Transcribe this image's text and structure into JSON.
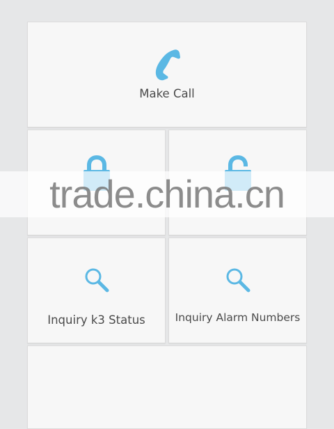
{
  "colors": {
    "accent": "#5bb8e4",
    "tile_bg": "#f7f7f7",
    "page_bg": "#e6e7e8",
    "label": "#4a4a4a"
  },
  "tiles": {
    "make_call": {
      "label": "Make Call",
      "icon": "phone-icon"
    },
    "lock": {
      "label": "",
      "icon": "lock-closed-icon"
    },
    "unlock": {
      "label": "",
      "icon": "lock-open-icon"
    },
    "inquiry_status": {
      "label": "Inquiry k3 Status",
      "icon": "search-icon"
    },
    "inquiry_alarm": {
      "label": "Inquiry Alarm Numbers",
      "icon": "search-icon"
    },
    "bottom": {
      "label": ""
    }
  },
  "watermark": {
    "text": "trade.china.cn"
  }
}
